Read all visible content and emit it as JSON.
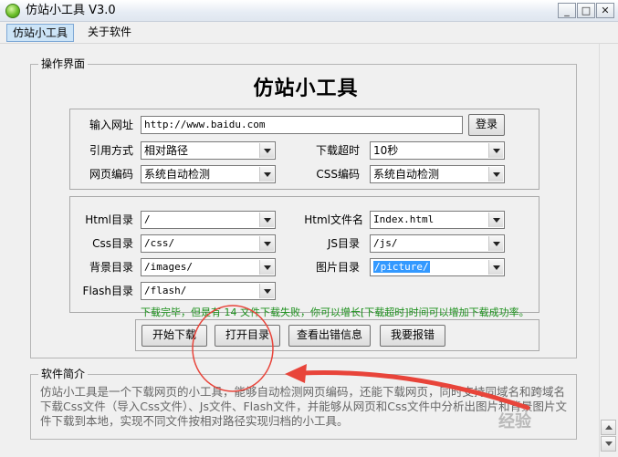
{
  "window": {
    "title": "仿站小工具 V3.0",
    "minimize_glyph": "_",
    "maximize_glyph": "□",
    "close_glyph": "✕"
  },
  "menu": {
    "items": [
      "仿站小工具",
      "关于软件"
    ]
  },
  "operation_group": {
    "legend": "操作界面",
    "heading": "仿站小工具",
    "url_label": "输入网址",
    "url_value": "http://www.baidu.com",
    "login_button": "登录",
    "ref_label": "引用方式",
    "ref_value": "相对路径",
    "timeout_label": "下载超时",
    "timeout_value": "10秒",
    "page_encoding_label": "网页编码",
    "page_encoding_value": "系统自动检测",
    "css_encoding_label": "CSS编码",
    "css_encoding_value": "系统自动检测"
  },
  "dirs": {
    "html_dir_label": "Html目录",
    "html_dir_value": "/",
    "html_file_label": "Html文件名",
    "html_file_value": "Index.html",
    "css_dir_label": "Css目录",
    "css_dir_value": "/css/",
    "js_dir_label": "JS目录",
    "js_dir_value": "/js/",
    "bg_dir_label": "背景目录",
    "bg_dir_value": "/images/",
    "pic_dir_label": "图片目录",
    "pic_dir_value": "/picture/",
    "flash_dir_label": "Flash目录",
    "flash_dir_value": "/flash/"
  },
  "status": {
    "message": "下载完毕，但是有 14 文件下载失败，你可以增长[下载超时]时间可以增加下载成功率。"
  },
  "actions": {
    "start": "开始下载",
    "open_dir": "打开目录",
    "view_errors": "查看出错信息",
    "report": "我要报错"
  },
  "intro": {
    "legend": "软件简介",
    "text": "仿站小工具是一个下载网页的小工具，能够自动检测网页编码，还能下载网页，同时支持同域名和跨域名下载Css文件（导入Css文件）、Js文件、Flash文件，并能够从网页和Css文件中分析出图片和背景图片文件下载到本地，实现不同文件按相对路径实现归档的小工具。"
  },
  "colors": {
    "status_green": "#1a8f1a",
    "selection_blue": "#3399ff",
    "annotation_red": "#e8443a"
  },
  "watermark": "经验"
}
